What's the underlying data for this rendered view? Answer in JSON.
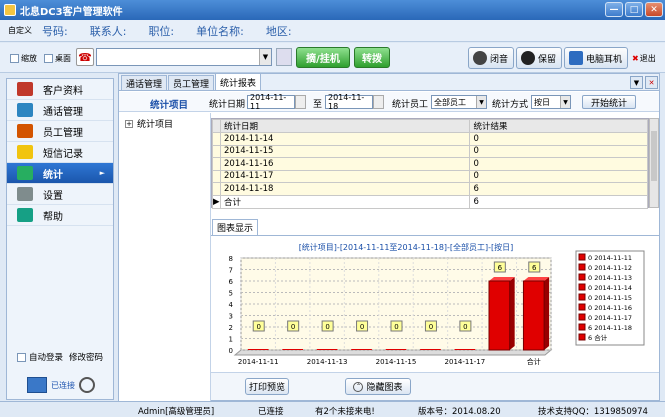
{
  "window": {
    "title": "北息DC3客户管理软件",
    "min": "—",
    "max": "□",
    "close": "✕"
  },
  "info": {
    "custom": "自定义",
    "fields": [
      "号码:",
      "联系人:",
      "职位:",
      "单位名称:",
      "地区:"
    ]
  },
  "toolbar": {
    "shrink": "缩放",
    "desktop": "桌面",
    "answer_btn": "摘/挂机",
    "transfer_btn": "转拨",
    "mute_btn": "闭音",
    "hold_btn": "保留",
    "headset_btn": "电脑耳机",
    "exit_btn": "退出"
  },
  "sidebar": {
    "items": [
      {
        "label": "客户资料",
        "color": "#c0392b"
      },
      {
        "label": "通话管理",
        "color": "#2e86c1"
      },
      {
        "label": "员工管理",
        "color": "#d35400"
      },
      {
        "label": "短信记录",
        "color": "#f1c40f"
      },
      {
        "label": "统计",
        "color": "#27ae60"
      },
      {
        "label": "设置",
        "color": "#7f8c8d"
      },
      {
        "label": "帮助",
        "color": "#16a085"
      }
    ],
    "active_index": 4,
    "auto_login": "自动登录",
    "change_pwd": "修改密码",
    "connected": "已连接"
  },
  "tabs": [
    "通话管理",
    "员工管理",
    "统计报表"
  ],
  "filter": {
    "title": "统计项目",
    "date_label": "统计日期",
    "date_from": "2014-11-11",
    "to": "至",
    "date_to": "2014-11-18",
    "staff_label": "统计员工",
    "staff_value": "全部员工",
    "method_label": "统计方式",
    "method_value": "按日",
    "start_btn": "开始统计"
  },
  "tree": {
    "root": "统计项目"
  },
  "grid": {
    "headers": [
      "统计日期",
      "统计结果"
    ],
    "rows": [
      [
        "2014-11-14",
        "0"
      ],
      [
        "2014-11-15",
        "0"
      ],
      [
        "2014-11-16",
        "0"
      ],
      [
        "2014-11-17",
        "0"
      ],
      [
        "2014-11-18",
        "6"
      ]
    ],
    "total": [
      "合计",
      "6"
    ]
  },
  "chart_tab": "图表显示",
  "chart_data": {
    "type": "bar",
    "title": "[统计项目]-[2014-11-11至2014-11-18]-[全部员工]-[按日]",
    "categories": [
      "2014-11-11",
      "2014-11-12",
      "2014-11-13",
      "2014-11-14",
      "2014-11-15",
      "2014-11-16",
      "2014-11-17",
      "2014-11-18",
      "合计"
    ],
    "values": [
      0,
      0,
      0,
      0,
      0,
      0,
      0,
      6,
      6
    ],
    "x_tick_labels": [
      "2014-11-11",
      "2014-11-13",
      "2014-11-15",
      "2014-11-17",
      "合计"
    ],
    "y_ticks": [
      0,
      1,
      2,
      3,
      4,
      5,
      6,
      7,
      8
    ],
    "ylim": [
      0,
      8
    ],
    "legend": [
      "0 2014-11-11",
      "0 2014-11-12",
      "0 2014-11-13",
      "0 2014-11-14",
      "0 2014-11-15",
      "0 2014-11-16",
      "0 2014-11-17",
      "6 2014-11-18",
      "6 合计"
    ],
    "legend_position": "right",
    "bar_color": "#e00000",
    "grid": true
  },
  "buttons": {
    "print": "打印预览",
    "hide_chart": "隐藏图表"
  },
  "status": {
    "user": "Admin[高级管理员]",
    "conn": "已连接",
    "incoming": "有2个未接来电!",
    "version": "版本号：2014.08.20",
    "support": "技术支持QQ：1319850974"
  }
}
